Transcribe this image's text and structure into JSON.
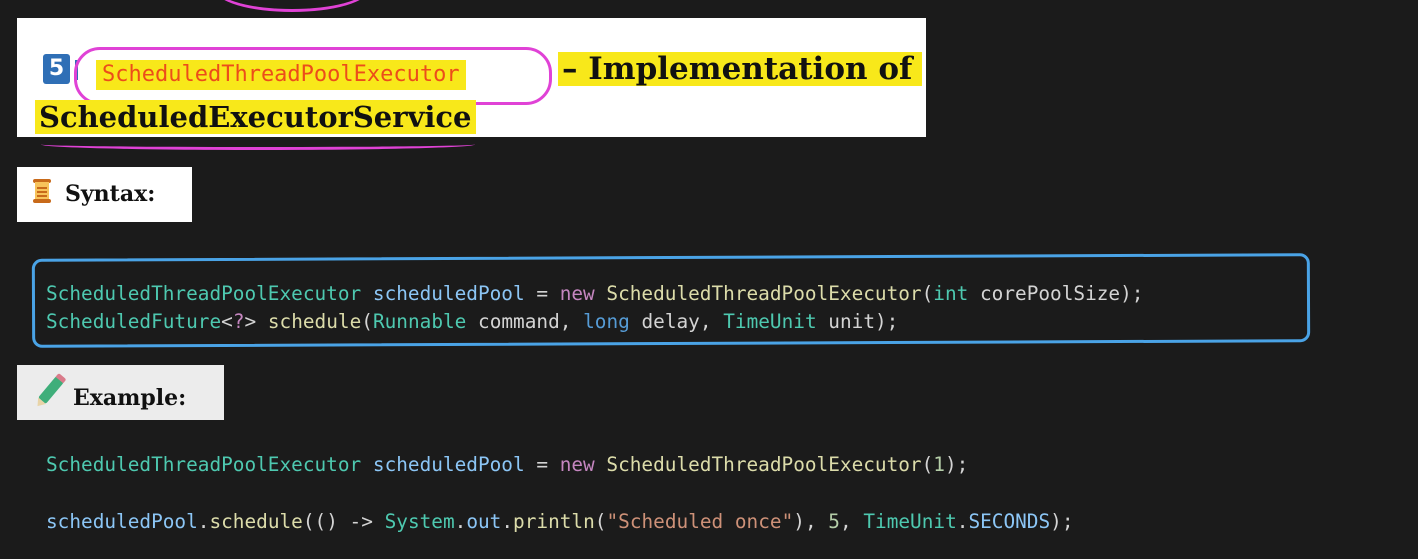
{
  "title": {
    "number": "5",
    "class_name": "ScheduledThreadPoolExecutor",
    "rest": "– Implementation of",
    "line2": "ScheduledExecutorService"
  },
  "sections": {
    "syntax_label": "Syntax:",
    "example_label": "Example:"
  },
  "icons": {
    "syntax": "scroll-icon",
    "example": "pencil-icon",
    "title": "number-5-icon"
  },
  "colors": {
    "highlight": "#f8e81a",
    "annotation_pink": "#e042d6",
    "annotation_blue": "#4aa3e6",
    "code_background": "#1b1b1b"
  },
  "syntax_code": [
    [
      {
        "t": "ScheduledThreadPoolExecutor",
        "c": "type"
      },
      {
        "t": " ",
        "c": "plain"
      },
      {
        "t": "scheduledPool",
        "c": "var"
      },
      {
        "t": " = ",
        "c": "plain"
      },
      {
        "t": "new",
        "c": "kw"
      },
      {
        "t": " ",
        "c": "plain"
      },
      {
        "t": "ScheduledThreadPoolExecutor",
        "c": "fn"
      },
      {
        "t": "(",
        "c": "plain"
      },
      {
        "t": "int",
        "c": "type"
      },
      {
        "t": " corePoolSize);",
        "c": "plain"
      }
    ],
    [
      {
        "t": "ScheduledFuture",
        "c": "type"
      },
      {
        "t": "<",
        "c": "plain"
      },
      {
        "t": "?",
        "c": "q"
      },
      {
        "t": "> ",
        "c": "plain"
      },
      {
        "t": "schedule",
        "c": "fn"
      },
      {
        "t": "(",
        "c": "plain"
      },
      {
        "t": "Runnable",
        "c": "type"
      },
      {
        "t": " command, ",
        "c": "plain"
      },
      {
        "t": "long",
        "c": "prim"
      },
      {
        "t": " delay, ",
        "c": "plain"
      },
      {
        "t": "TimeUnit",
        "c": "type"
      },
      {
        "t": " unit);",
        "c": "plain"
      }
    ]
  ],
  "example_code": [
    [
      {
        "t": "ScheduledThreadPoolExecutor",
        "c": "type"
      },
      {
        "t": " ",
        "c": "plain"
      },
      {
        "t": "scheduledPool",
        "c": "var"
      },
      {
        "t": " = ",
        "c": "plain"
      },
      {
        "t": "new",
        "c": "kw"
      },
      {
        "t": " ",
        "c": "plain"
      },
      {
        "t": "ScheduledThreadPoolExecutor",
        "c": "fn"
      },
      {
        "t": "(",
        "c": "plain"
      },
      {
        "t": "1",
        "c": "num"
      },
      {
        "t": ");",
        "c": "plain"
      }
    ],
    [
      {
        "t": "scheduledPool",
        "c": "var"
      },
      {
        "t": ".",
        "c": "plain"
      },
      {
        "t": "schedule",
        "c": "fn"
      },
      {
        "t": "(() -> ",
        "c": "plain"
      },
      {
        "t": "System",
        "c": "type"
      },
      {
        "t": ".",
        "c": "plain"
      },
      {
        "t": "out",
        "c": "var"
      },
      {
        "t": ".",
        "c": "plain"
      },
      {
        "t": "println",
        "c": "fn"
      },
      {
        "t": "(",
        "c": "plain"
      },
      {
        "t": "\"Scheduled once\"",
        "c": "str"
      },
      {
        "t": "), ",
        "c": "plain"
      },
      {
        "t": "5",
        "c": "num"
      },
      {
        "t": ", ",
        "c": "plain"
      },
      {
        "t": "TimeUnit",
        "c": "type"
      },
      {
        "t": ".",
        "c": "plain"
      },
      {
        "t": "SECONDS",
        "c": "var"
      },
      {
        "t": ");",
        "c": "plain"
      }
    ]
  ]
}
